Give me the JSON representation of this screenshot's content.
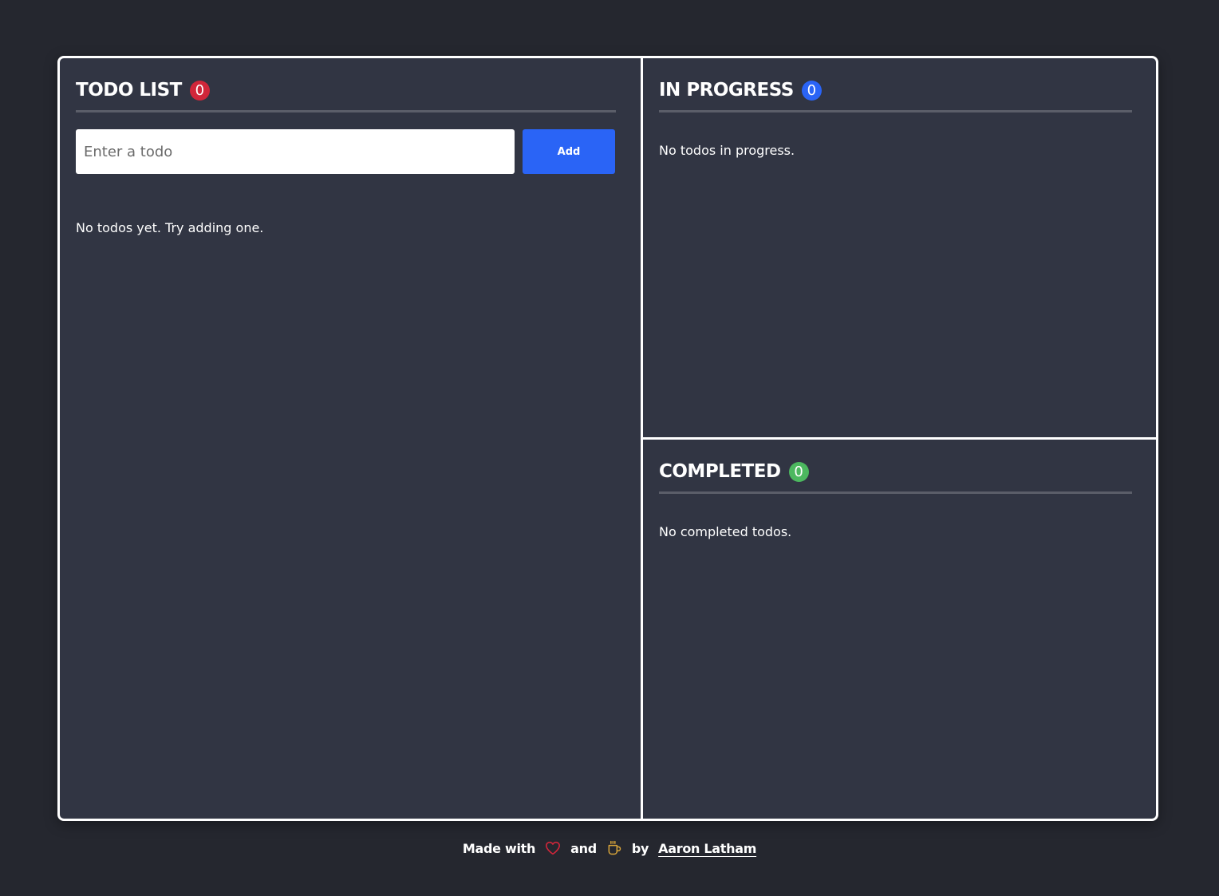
{
  "colors": {
    "background": "#25272f",
    "board": "#313543",
    "todo_badge": "#d1263a",
    "progress_badge": "#2a64f6",
    "completed_badge": "#4cb85f",
    "add_button": "#2a64f6",
    "heart_icon": "#d1263a",
    "coffee_icon": "#d9a53a"
  },
  "todo": {
    "title": "TODO LIST",
    "count": "0",
    "input_placeholder": "Enter a todo",
    "add_label": "Add",
    "empty_text": "No todos yet. Try adding one."
  },
  "in_progress": {
    "title": "IN PROGRESS",
    "count": "0",
    "empty_text": "No todos in progress."
  },
  "completed": {
    "title": "COMPLETED",
    "count": "0",
    "empty_text": "No completed todos."
  },
  "footer": {
    "made_with": "Made with",
    "and": "and",
    "by": "by",
    "author": "Aaron Latham",
    "heart_icon": "heart-icon",
    "coffee_icon": "coffee-icon"
  }
}
